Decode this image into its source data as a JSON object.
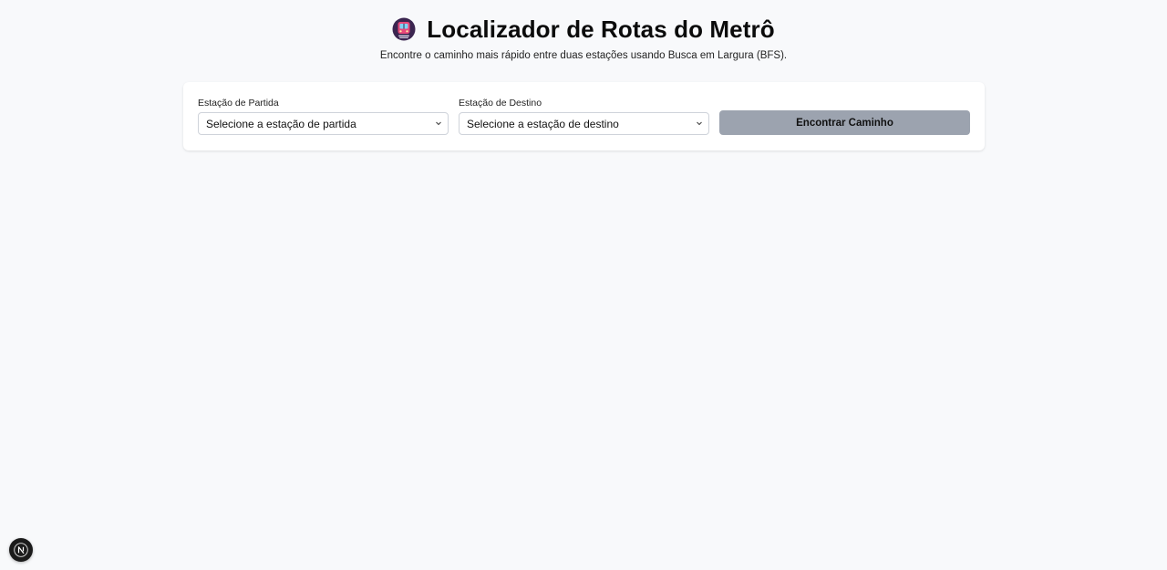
{
  "header": {
    "title_icon": "metro-train-icon",
    "title": "Localizador de Rotas do Metrô",
    "subtitle": "Encontre o caminho mais rápido entre duas estações usando Busca em Largura (BFS)."
  },
  "form": {
    "origin": {
      "label": "Estação de Partida",
      "selected": "Selecione a estação de partida"
    },
    "destination": {
      "label": "Estação de Destino",
      "selected": "Selecione a estação de destino"
    },
    "submit_label": "Encontrar Caminho",
    "submit_disabled": true
  },
  "dev_badge": {
    "icon": "nextjs-logo-icon",
    "letter": "N"
  },
  "colors": {
    "background": "#f8f9fb",
    "card": "#ffffff",
    "button_disabled": "#9ca3af",
    "icon_accent": "#e8487a",
    "icon_dark": "#3b2550"
  }
}
